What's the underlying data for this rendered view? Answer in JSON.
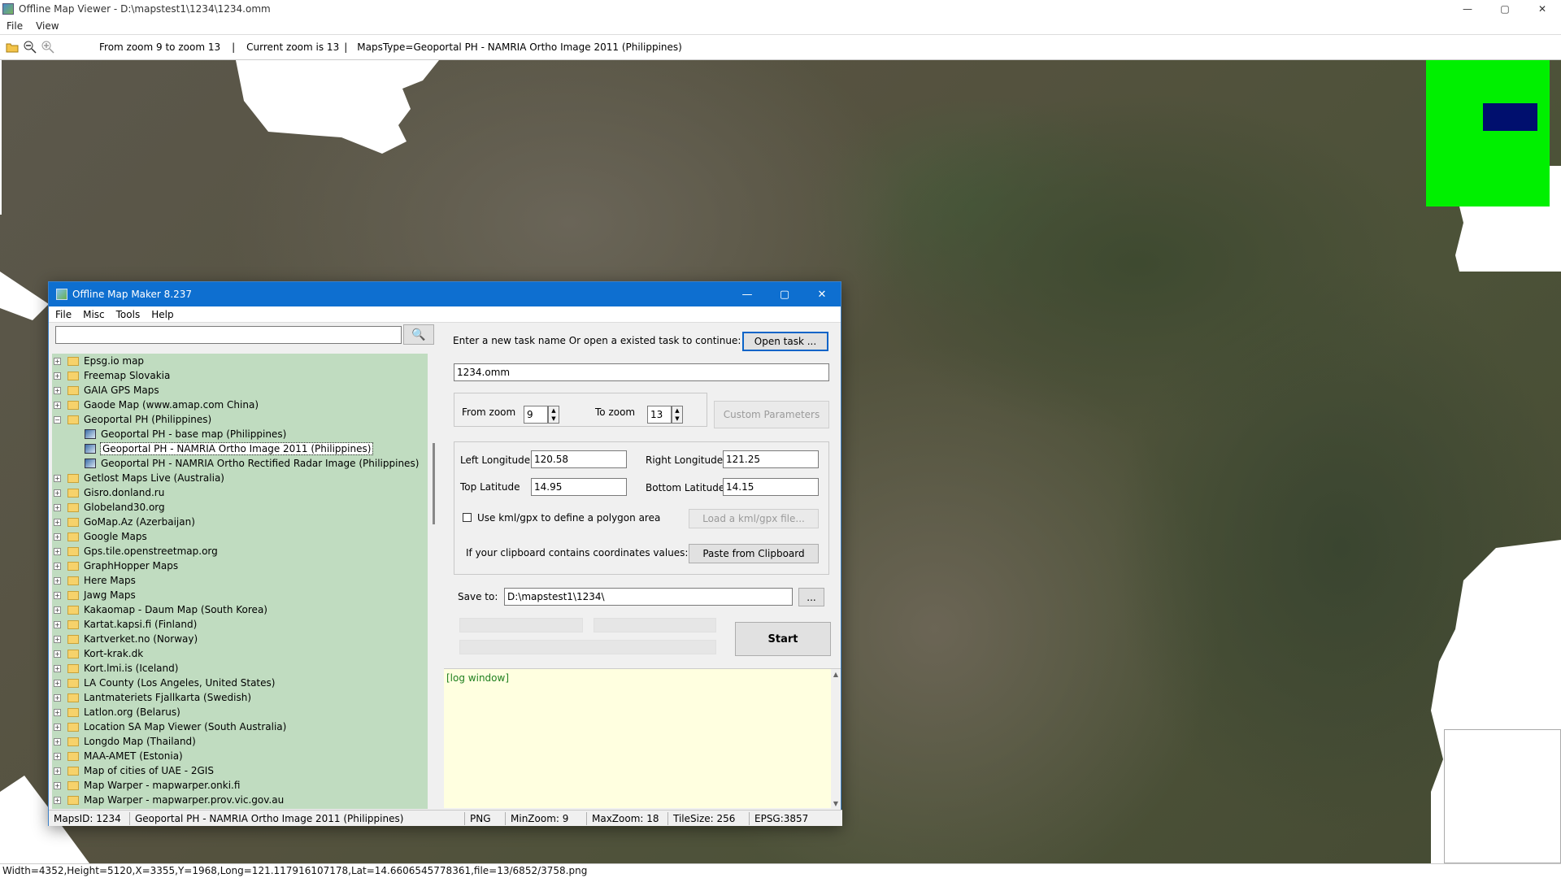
{
  "window": {
    "title": "Offline Map Viewer - D:\\mapstest1\\1234\\1234.omm",
    "minimize": "—",
    "maximize": "▢",
    "close": "✕"
  },
  "menu": [
    "File",
    "View"
  ],
  "toolbar": {
    "zoom_range": "From zoom 9 to zoom 13",
    "sep1": "|",
    "current_zoom": "Current zoom is 13",
    "sep2": "|",
    "maps_type": "MapsType=Geoportal PH - NAMRIA Ortho Image 2011 (Philippines)"
  },
  "status": "Width=4352,Height=5120,X=3355,Y=1968,Long=121.117916107178,Lat=14.6606545778361,file=13/6852/3758.png",
  "colors": {
    "minimap_bg": "#00f000",
    "minimap_viewport": "#000f6e",
    "dialog_title": "#0e6fd0",
    "tree_bg": "#c0dcc0",
    "log_bg": "#ffffe0"
  },
  "dialog": {
    "title": "Offline Map Maker 8.237",
    "menu": [
      "File",
      "Misc",
      "Tools",
      "Help"
    ],
    "search_icon": "🔍",
    "tree": [
      {
        "label": "Epsg.io map",
        "type": "folder"
      },
      {
        "label": "Freemap Slovakia",
        "type": "folder"
      },
      {
        "label": "GAIA GPS Maps",
        "type": "folder"
      },
      {
        "label": "Gaode Map (www.amap.com China)",
        "type": "folder"
      },
      {
        "label": "Geoportal PH (Philippines)",
        "type": "open-folder"
      },
      {
        "label": "Geoportal PH - base map (Philippines)",
        "type": "map"
      },
      {
        "label": "Geoportal PH - NAMRIA Ortho Image 2011 (Philippines)",
        "type": "map-selected"
      },
      {
        "label": "Geoportal PH - NAMRIA Ortho Rectified Radar Image (Philippines)",
        "type": "map"
      },
      {
        "label": "Getlost Maps Live (Australia)",
        "type": "folder"
      },
      {
        "label": "Gisro.donland.ru",
        "type": "folder"
      },
      {
        "label": "Globeland30.org",
        "type": "folder"
      },
      {
        "label": "GoMap.Az (Azerbaijan)",
        "type": "folder"
      },
      {
        "label": "Google Maps",
        "type": "folder"
      },
      {
        "label": "Gps.tile.openstreetmap.org",
        "type": "folder"
      },
      {
        "label": "GraphHopper Maps",
        "type": "folder"
      },
      {
        "label": "Here Maps",
        "type": "folder"
      },
      {
        "label": "Jawg Maps",
        "type": "folder"
      },
      {
        "label": "Kakaomap - Daum Map (South Korea)",
        "type": "folder"
      },
      {
        "label": "Kartat.kapsi.fi (Finland)",
        "type": "folder"
      },
      {
        "label": "Kartverket.no (Norway)",
        "type": "folder"
      },
      {
        "label": "Kort-krak.dk",
        "type": "folder"
      },
      {
        "label": "Kort.lmi.is (Iceland)",
        "type": "folder"
      },
      {
        "label": "LA County (Los Angeles, United States)",
        "type": "folder"
      },
      {
        "label": "Lantmateriets Fjallkarta (Swedish)",
        "type": "folder"
      },
      {
        "label": "Latlon.org (Belarus)",
        "type": "folder"
      },
      {
        "label": "Location SA Map Viewer (South Australia)",
        "type": "folder"
      },
      {
        "label": "Longdo Map (Thailand)",
        "type": "folder"
      },
      {
        "label": "MAA-AMET (Estonia)",
        "type": "folder"
      },
      {
        "label": "Map of cities of UAE - 2GIS",
        "type": "folder"
      },
      {
        "label": "Map Warper - mapwarper.onki.fi",
        "type": "folder"
      },
      {
        "label": "Map Warper - mapwarper.prov.vic.gov.au",
        "type": "folder"
      }
    ],
    "task_prompt": "Enter a new task name Or open a existed task to continue:",
    "open_task": "Open task ...",
    "task_name": "1234.omm",
    "from_zoom_label": "From zoom",
    "from_zoom": "9",
    "to_zoom_label": "To zoom",
    "to_zoom": "13",
    "custom_params": "Custom Parameters",
    "left_lon_label": "Left Longitude",
    "left_lon": "120.58",
    "right_lon_label": "Right Longitude",
    "right_lon": "121.25",
    "top_lat_label": "Top Latitude",
    "top_lat": "14.95",
    "bottom_lat_label": "Bottom Latitude",
    "bottom_lat": "14.15",
    "use_kml": "Use kml/gpx to define a polygon area",
    "load_kml": "Load a kml/gpx file...",
    "clipboard_label": "If your clipboard contains coordinates values:",
    "paste_clipboard": "Paste from Clipboard",
    "save_to_label": "Save to:",
    "save_to": "D:\\mapstest1\\1234\\",
    "browse": "...",
    "start": "Start",
    "log": "[log window]",
    "status": {
      "maps_id": "MapsID: 1234",
      "maps_name": "Geoportal PH - NAMRIA Ortho Image 2011 (Philippines)",
      "format": "PNG",
      "min_zoom": "MinZoom: 9",
      "max_zoom": "MaxZoom: 18",
      "tile_size": "TileSize: 256",
      "epsg": "EPSG:3857"
    }
  }
}
